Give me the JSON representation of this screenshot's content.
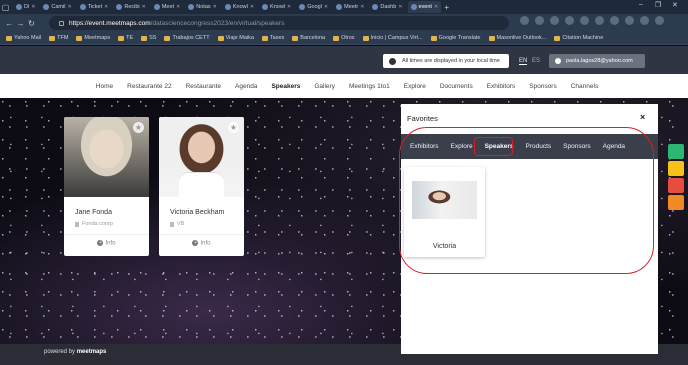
{
  "browser": {
    "tabs": [
      {
        "label": "Di",
        "active": false
      },
      {
        "label": "Camil",
        "active": false
      },
      {
        "label": "Ticket",
        "active": false
      },
      {
        "label": "Recibi",
        "active": false
      },
      {
        "label": "Meet",
        "active": false
      },
      {
        "label": "Notas",
        "active": false
      },
      {
        "label": "Knowl",
        "active": false
      },
      {
        "label": "Knowl",
        "active": false
      },
      {
        "label": "Googl",
        "active": false
      },
      {
        "label": "Meetr",
        "active": false
      },
      {
        "label": "Dashb",
        "active": false
      },
      {
        "label": "event",
        "active": true
      }
    ],
    "url_host": "https://event.meetmaps.com",
    "url_path": "/datasciencecongress2023/en/virtual/speakers",
    "bookmarks": [
      "Yahoo Mail",
      "TFM",
      "Meetmaps",
      "TE",
      "SS",
      "Trabajos CETT",
      "Viaje Maika",
      "Taxes",
      "Barcelona",
      "Otros",
      "Inicio | Campus Virt...",
      "Google Translate",
      "Masonlive Outlook...",
      "Citation Machine"
    ]
  },
  "site": {
    "notice": "All times are displayed in your local time",
    "lang_en": "EN",
    "lang_es": "ES",
    "user_email": "paola.lagos28@yahoo.com",
    "nav": [
      "Home",
      "Restaurante 22",
      "Restaurante",
      "Agenda",
      "Speakers",
      "Gallery",
      "Meetings 1to1",
      "Explore",
      "Documents",
      "Exhibitors",
      "Sponsors",
      "Channels"
    ],
    "nav_active": "Speakers",
    "speakers": [
      {
        "name": "Jane Fonda",
        "company": "Fonda coorp",
        "info": "Info"
      },
      {
        "name": "Victoria Beckham",
        "company": "VB",
        "info": "Info"
      }
    ],
    "powered_prefix": "powered by",
    "powered_brand": "meetmaps"
  },
  "favorites": {
    "title": "Favorites",
    "close": "×",
    "tabs": [
      "Exhibitors",
      "Explore",
      "Speakers",
      "Products",
      "Sponsors",
      "Agenda"
    ],
    "active_tab": "Speakers",
    "items": [
      {
        "name": "Victoria"
      }
    ]
  },
  "colors": {
    "annotation": "#d4202a",
    "widget_colors": [
      "#2bb673",
      "#f6c21a",
      "#e84c3d",
      "#f08a24"
    ]
  }
}
